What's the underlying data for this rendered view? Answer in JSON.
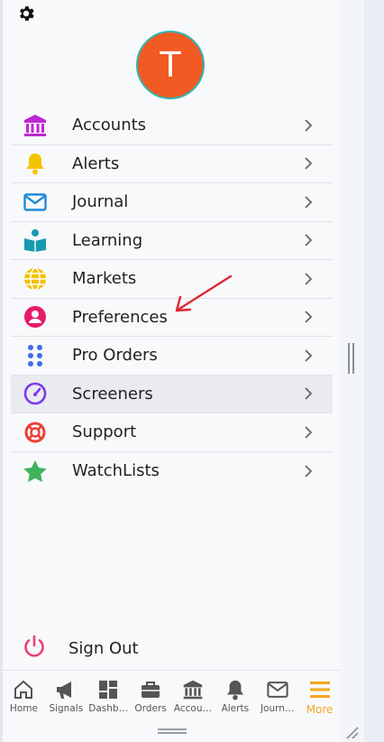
{
  "profile": {
    "avatar_initial": "T"
  },
  "menu": [
    {
      "label": "Accounts",
      "icon": "bank-icon",
      "color": "#c026d3"
    },
    {
      "label": "Alerts",
      "icon": "bell-icon",
      "color": "#f5c400"
    },
    {
      "label": "Journal",
      "icon": "envelope-icon",
      "color": "#1f8ad8"
    },
    {
      "label": "Learning",
      "icon": "book-reader-icon",
      "color": "#169ab0"
    },
    {
      "label": "Markets",
      "icon": "globe-icon",
      "color": "#f2c200"
    },
    {
      "label": "Preferences",
      "icon": "user-circle-icon",
      "color": "#e51b6a"
    },
    {
      "label": "Pro Orders",
      "icon": "grid-dots-icon",
      "color": "#3b6fe0"
    },
    {
      "label": "Screeners",
      "icon": "speedometer-icon",
      "color": "#7c3aed",
      "active": true
    },
    {
      "label": "Support",
      "icon": "lifebuoy-icon",
      "color": "#ef3e36"
    },
    {
      "label": "WatchLists",
      "icon": "star-icon",
      "color": "#3fb35c"
    }
  ],
  "signout": {
    "label": "Sign Out",
    "icon": "power-icon",
    "color": "#ec407a"
  },
  "tabs": [
    {
      "label": "Home",
      "icon": "home-icon"
    },
    {
      "label": "Signals",
      "icon": "megaphone-icon"
    },
    {
      "label": "Dashb…",
      "icon": "dashboard-icon"
    },
    {
      "label": "Orders",
      "icon": "briefcase-icon"
    },
    {
      "label": "Accou…",
      "icon": "bank-icon"
    },
    {
      "label": "Alerts",
      "icon": "bell-icon"
    },
    {
      "label": "Journ…",
      "icon": "envelope-icon"
    },
    {
      "label": "More",
      "icon": "menu-icon",
      "active": true
    }
  ],
  "colors": {
    "accent": "#f5a623",
    "avatar": "#f15a22",
    "avatar_ring": "#2fb6b6",
    "annotation_arrow": "#e0242e"
  }
}
